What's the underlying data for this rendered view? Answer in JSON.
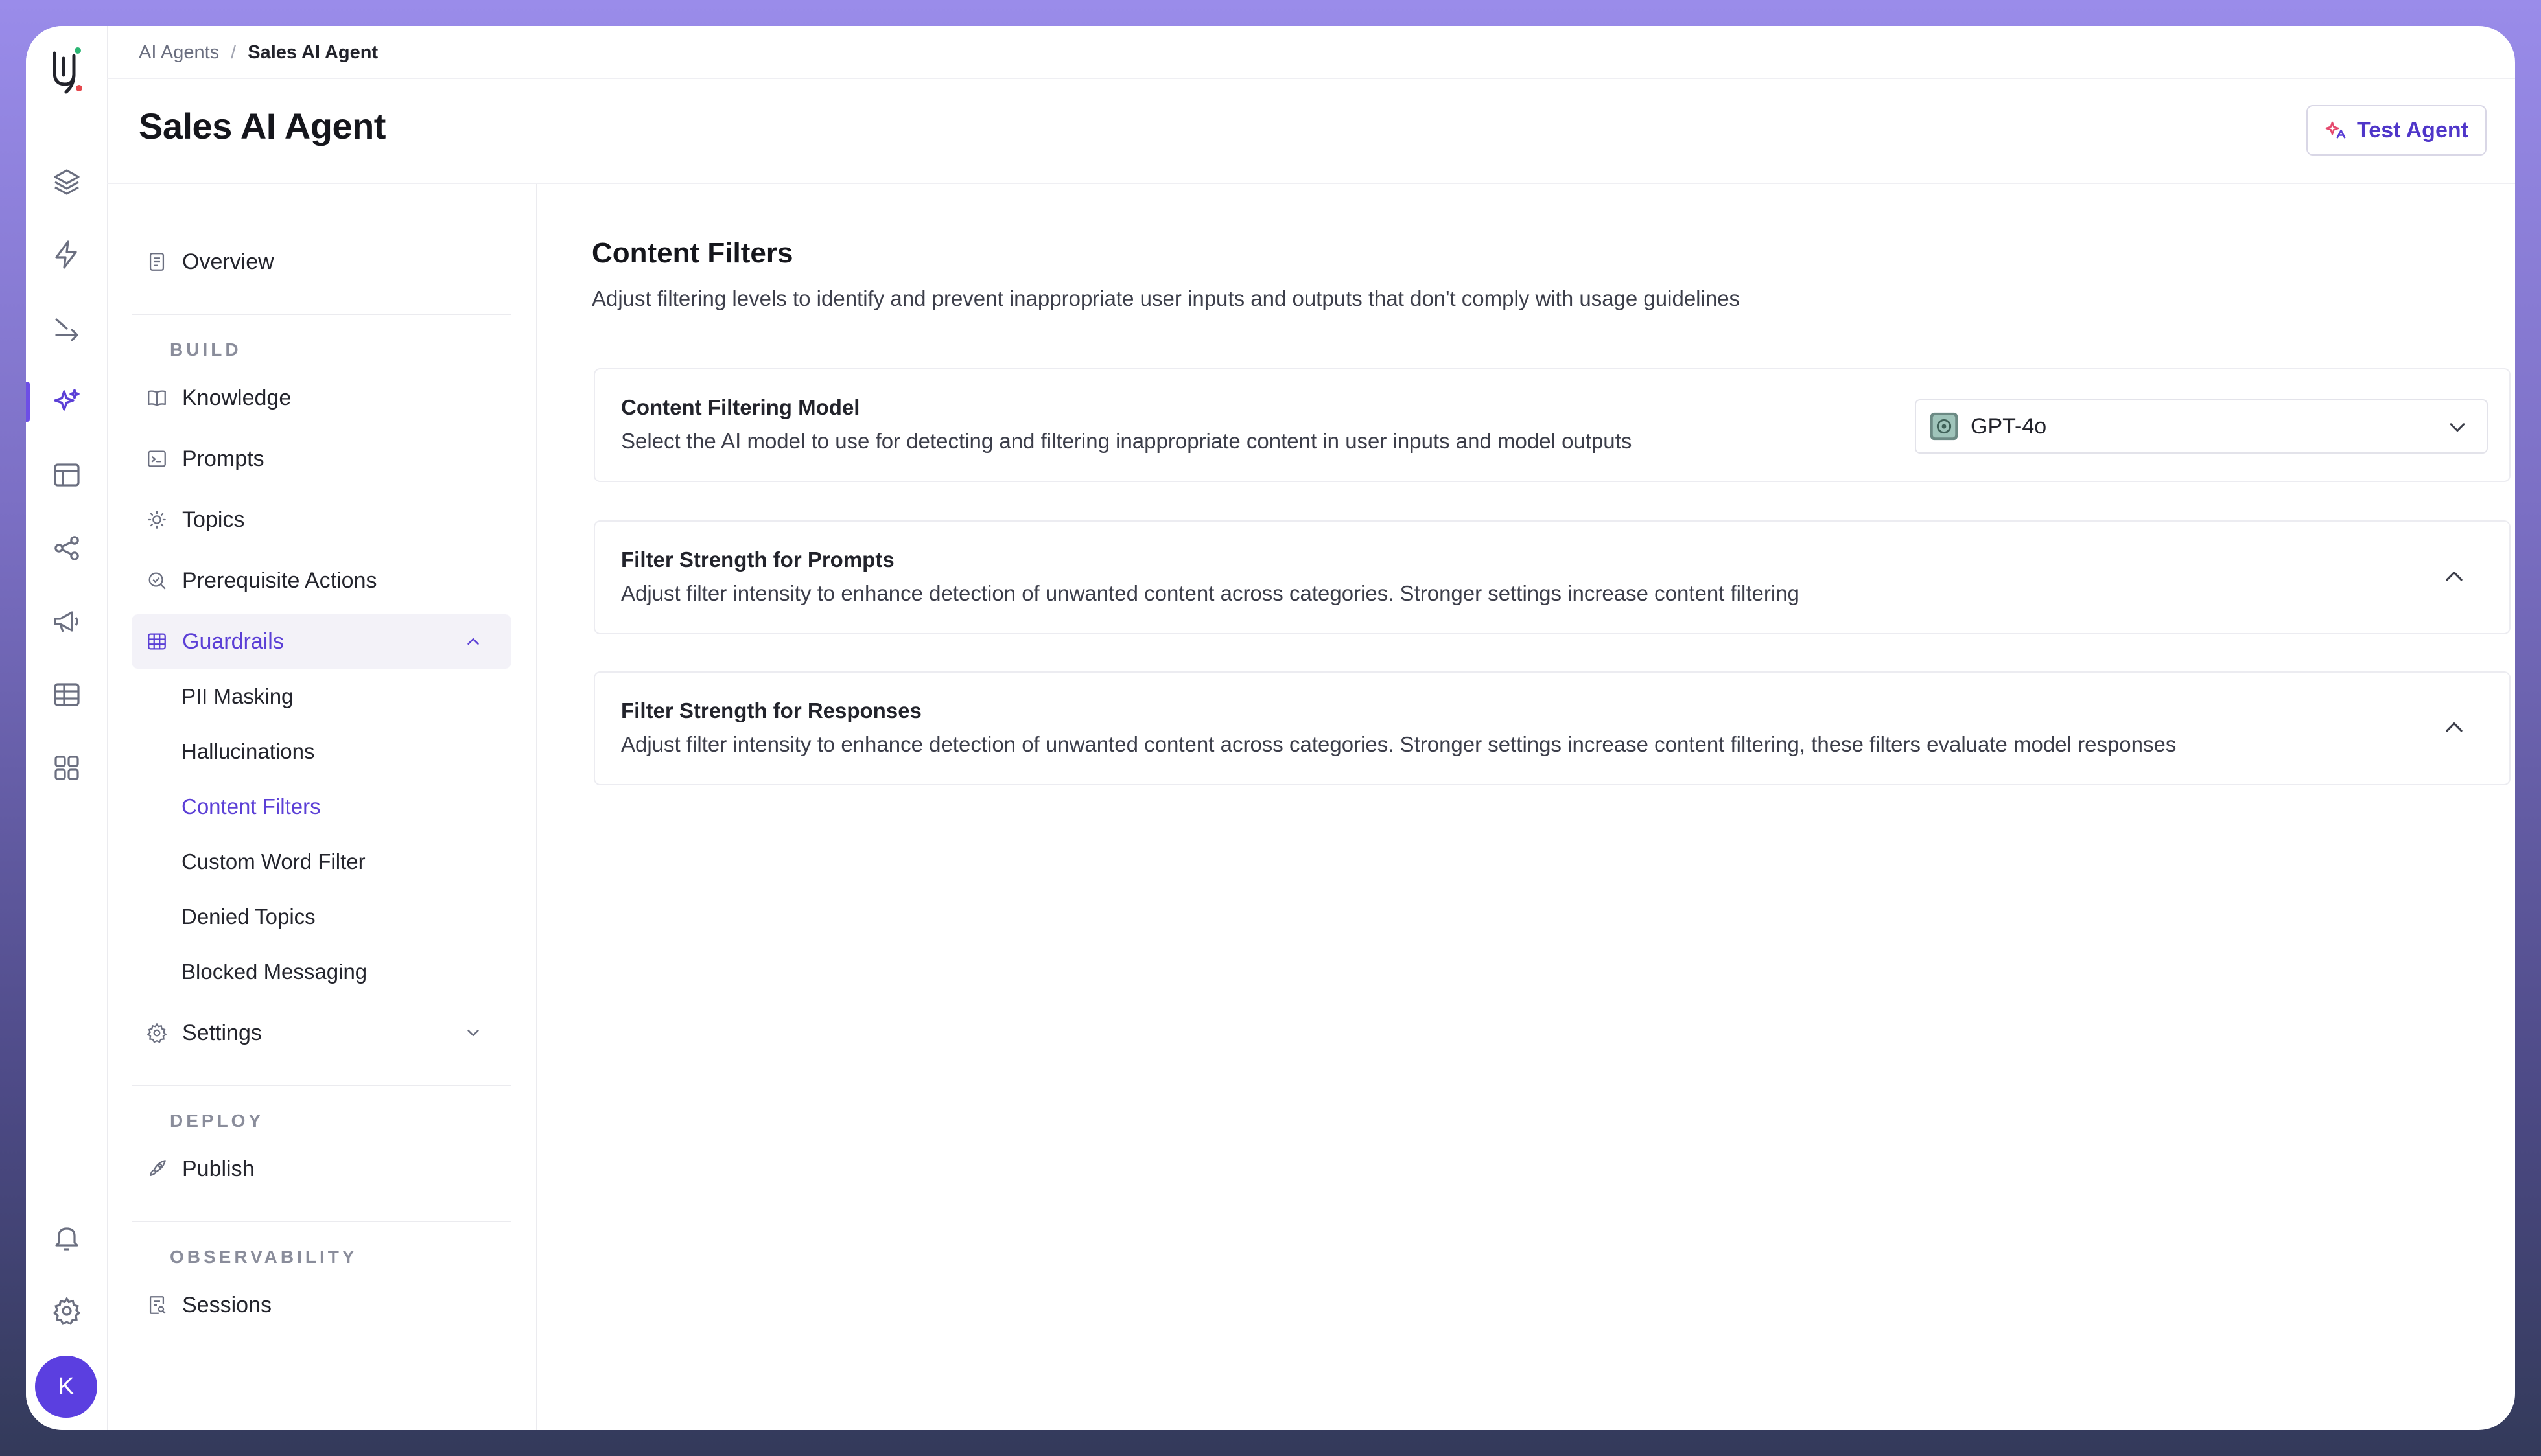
{
  "breadcrumb": {
    "parent": "AI Agents",
    "separator": "/",
    "current": "Sales AI Agent"
  },
  "header": {
    "title": "Sales AI Agent",
    "test_button": "Test Agent"
  },
  "rail": {
    "icons": [
      "layers-icon",
      "bolt-icon",
      "route-icon",
      "sparkles-icon",
      "layout-icon",
      "share-icon",
      "megaphone-icon",
      "table-icon",
      "grid-icon"
    ],
    "bottom_icons": [
      "bell-icon",
      "gear-icon"
    ],
    "avatar_initial": "K"
  },
  "sidebar": {
    "overview": "Overview",
    "build_label": "BUILD",
    "knowledge": "Knowledge",
    "prompts": "Prompts",
    "topics": "Topics",
    "prerequisite": "Prerequisite Actions",
    "guardrails": "Guardrails",
    "guardrails_items": [
      "PII Masking",
      "Hallucinations",
      "Content Filters",
      "Custom Word Filter",
      "Denied Topics",
      "Blocked Messaging"
    ],
    "settings": "Settings",
    "deploy_label": "DEPLOY",
    "publish": "Publish",
    "observability_label": "OBSERVABILITY",
    "sessions": "Sessions"
  },
  "content": {
    "title": "Content Filters",
    "description": "Adjust filtering levels to identify and prevent inappropriate user inputs and outputs that don't comply with usage guidelines",
    "model_card": {
      "title": "Content Filtering Model",
      "description": "Select the AI model to use for detecting and filtering inappropriate content in user inputs and model outputs",
      "selected_model": "GPT-4o"
    },
    "prompts_card": {
      "title": "Filter Strength for Prompts",
      "description": "Adjust filter intensity to enhance detection of unwanted content across categories. Stronger settings increase content filtering"
    },
    "responses_card": {
      "title": "Filter Strength for Responses",
      "description": "Adjust filter intensity to enhance detection of unwanted content across categories. Stronger settings increase content filtering, these filters evaluate model responses"
    }
  },
  "colors": {
    "accent": "#5b3fd6",
    "avatar": "#5b3fe0"
  }
}
